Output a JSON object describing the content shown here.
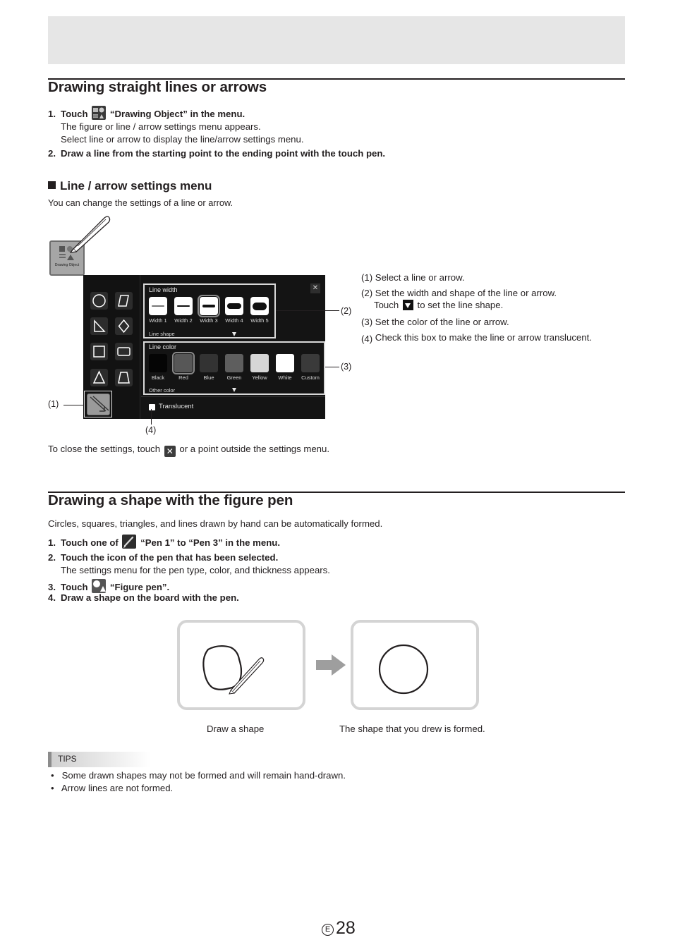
{
  "header_band": "",
  "section1": {
    "title": "Drawing straight lines or arrows",
    "steps": [
      {
        "num": "1.",
        "pre": "Touch",
        "icon": "drawing-object-icon",
        "post": "“Drawing Object” in the menu.",
        "sub": [
          "The figure or line / arrow settings menu appears.",
          "Select line or arrow to display the line/arrow settings menu."
        ]
      },
      {
        "num": "2.",
        "text": "Draw a line from the starting point to the ending point with the touch pen."
      }
    ],
    "subheading": "Line / arrow settings menu",
    "intro": "You can change the settings of a line or arrow.",
    "menu_icon_label": "Drawing Object",
    "panel": {
      "line_width_title": "Line width",
      "widths": [
        "Width 1",
        "Width 2",
        "Width 3",
        "Width 4",
        "Width 5"
      ],
      "selected_width": "Width 3",
      "line_shape_label": "Line shape",
      "line_color_title": "Line color",
      "colors": [
        {
          "name": "Black",
          "hex": "#050505"
        },
        {
          "name": "Red",
          "hex": "#575757"
        },
        {
          "name": "Blue",
          "hex": "#333333"
        },
        {
          "name": "Green",
          "hex": "#5e5e5e"
        },
        {
          "name": "Yellow",
          "hex": "#d6d6d6"
        },
        {
          "name": "White",
          "hex": "#ffffff"
        },
        {
          "name": "Custom",
          "hex": "#3a3a3a"
        }
      ],
      "selected_color": "Red",
      "other_color_label": "Other color",
      "translucent_label": "Translucent",
      "close_glyph": "✕",
      "shapes": [
        "circle",
        "parallelogram",
        "right-triangle",
        "diamond",
        "square",
        "rounded-rectangle",
        "triangle",
        "trapezoid",
        "line-arrow"
      ]
    },
    "callouts": {
      "c1": "(1)",
      "c2": "(2)",
      "c3": "(3)",
      "c4": "(4)"
    },
    "descriptions": {
      "d1": "(1) Select a line or arrow.",
      "d2": "(2) Set the width and shape of the line or arrow.",
      "d2b_pre": "Touch",
      "d2b_post": "to set the line shape.",
      "d3": "(3) Set the color of the line or arrow.",
      "d4_num": "(4)",
      "d4": "Check this box to make the line or arrow translucent."
    },
    "close_note_pre": "To close the settings, touch",
    "close_note_post": "or a point outside the settings menu."
  },
  "section2": {
    "title": "Drawing a shape with the figure pen",
    "intro": "Circles, squares, triangles, and lines drawn by hand can be automatically formed.",
    "steps": [
      {
        "num": "1.",
        "pre": "Touch one of",
        "post": "“Pen 1” to “Pen 3” in the menu."
      },
      {
        "num": "2.",
        "text": "Touch the icon of the pen that has been selected.",
        "sub": "The settings menu for the pen type, color, and thickness appears."
      },
      {
        "num": "3.",
        "pre": "Touch",
        "post": "“Figure pen”."
      },
      {
        "num": "4.",
        "text": "Draw a shape on the board with the pen."
      }
    ],
    "caption_left": "Draw a shape",
    "caption_right": "The shape that you drew is formed."
  },
  "tips": {
    "label": "TIPS",
    "items": [
      "Some drawn shapes may not be formed and will remain hand-drawn.",
      "Arrow lines are not formed."
    ]
  },
  "footer": {
    "lang_badge": "E",
    "page_number": "28"
  }
}
